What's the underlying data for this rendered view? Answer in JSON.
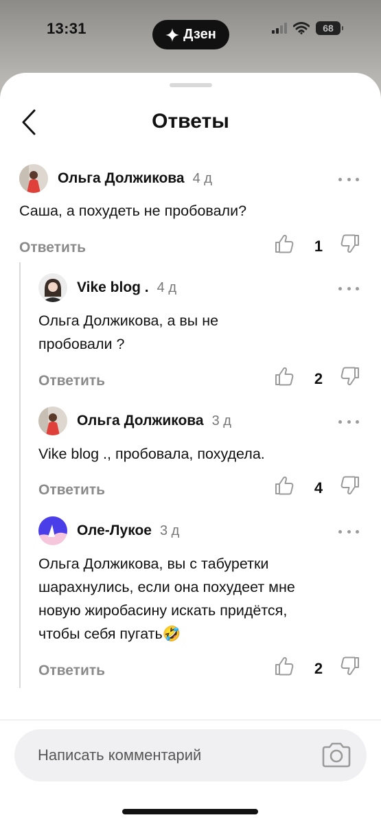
{
  "status_bar": {
    "time": "13:31",
    "app_pill": "Дзен",
    "battery": "68"
  },
  "header": {
    "title": "Ответы"
  },
  "comments": [
    {
      "author": "Ольга Должикова",
      "age": "4 д",
      "text_lines": [
        "Саша, а похудеть не пробовали?"
      ],
      "reply": "Ответить",
      "likes": "1"
    },
    {
      "author": "Vike blog .",
      "age": "4 д",
      "text_lines": [
        "Ольга Должикова, а вы не",
        "пробовали ?"
      ],
      "reply": "Ответить",
      "likes": "2"
    },
    {
      "author": "Ольга Должикова",
      "age": "3 д",
      "text_lines": [
        "Vike blog ., пробовала, похудела."
      ],
      "reply": "Ответить",
      "likes": "4"
    },
    {
      "author": "Оле-Лукое",
      "age": "3 д",
      "text_lines": [
        "Ольга Должикова, вы с табуретки",
        "шарахнулись, если она похудеет мне",
        "новую жиробасину искать придётся,",
        "чтобы себя пугать🤣"
      ],
      "reply": "Ответить",
      "likes": "2"
    }
  ],
  "composer": {
    "placeholder": "Написать комментарий"
  },
  "icons": {
    "back": "chevron-left-icon",
    "more": "more-dots-icon",
    "like": "thumb-up-icon",
    "dislike": "thumb-down-icon",
    "camera": "camera-icon"
  }
}
